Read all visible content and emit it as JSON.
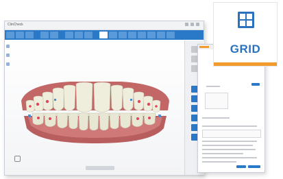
{
  "badge": {
    "label": "GRID",
    "icon": "grid-icon",
    "accent": "#f39a2d",
    "brand": "#2a72be"
  },
  "window": {
    "title": "ClinCheck",
    "filename": "",
    "toolbar_color": "#2a78c8"
  },
  "viewer": {
    "subject": "dental-arch-3d-model"
  }
}
